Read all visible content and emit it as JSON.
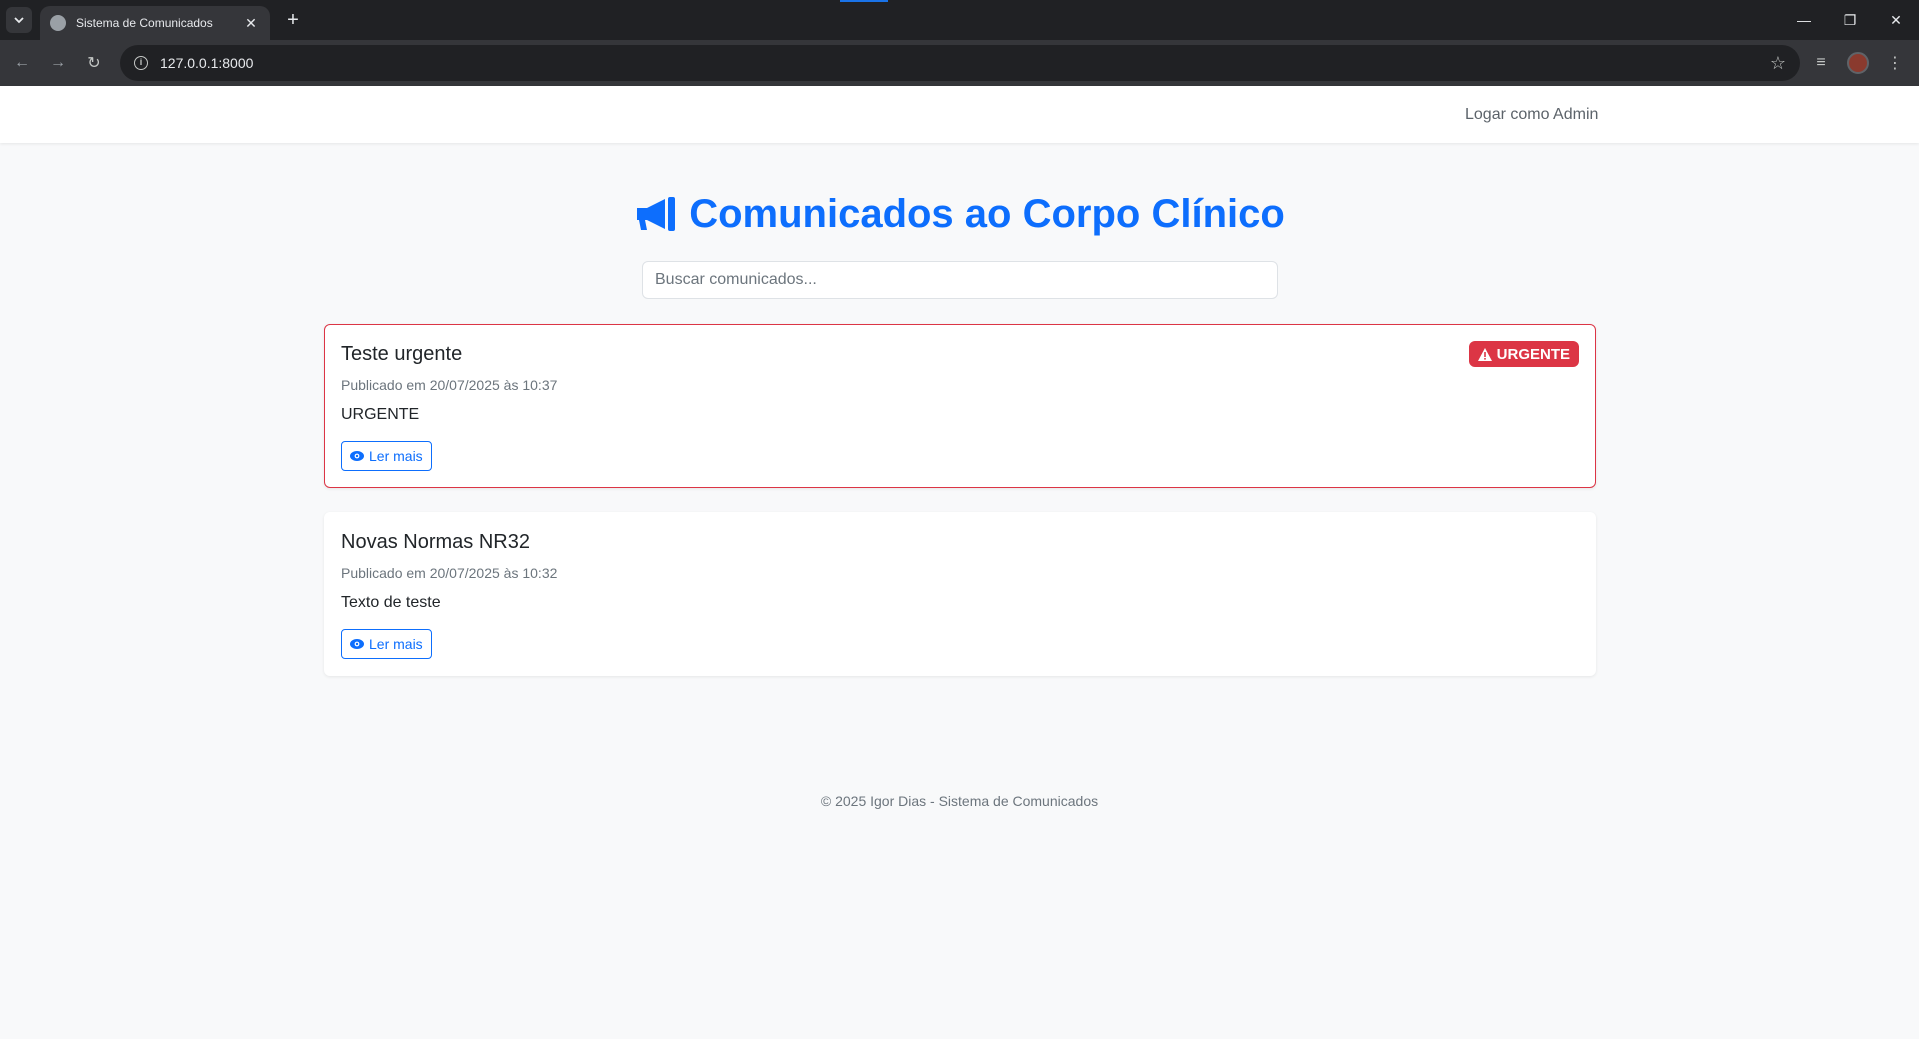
{
  "browser": {
    "tab_title": "Sistema de Comunicados",
    "url": "127.0.0.1:8000"
  },
  "navbar": {
    "admin_link": "Logar como Admin"
  },
  "main": {
    "heading": "Comunicados ao Corpo Clínico",
    "search_placeholder": "Buscar comunicados..."
  },
  "posts": [
    {
      "title": "Teste urgente",
      "date": "Publicado em 20/07/2025 às 10:37",
      "text": "URGENTE",
      "badge": "URGENTE",
      "button": "Ler mais"
    },
    {
      "title": "Novas Normas NR32",
      "date": "Publicado em 20/07/2025 às 10:32",
      "text": "Texto de teste",
      "button": "Ler mais"
    }
  ],
  "footer": {
    "text": "© 2025 Igor Dias - Sistema de Comunicados"
  },
  "colors": {
    "primary": "#0d6efd",
    "danger": "#dc3545",
    "background": "#f8f9fa"
  }
}
